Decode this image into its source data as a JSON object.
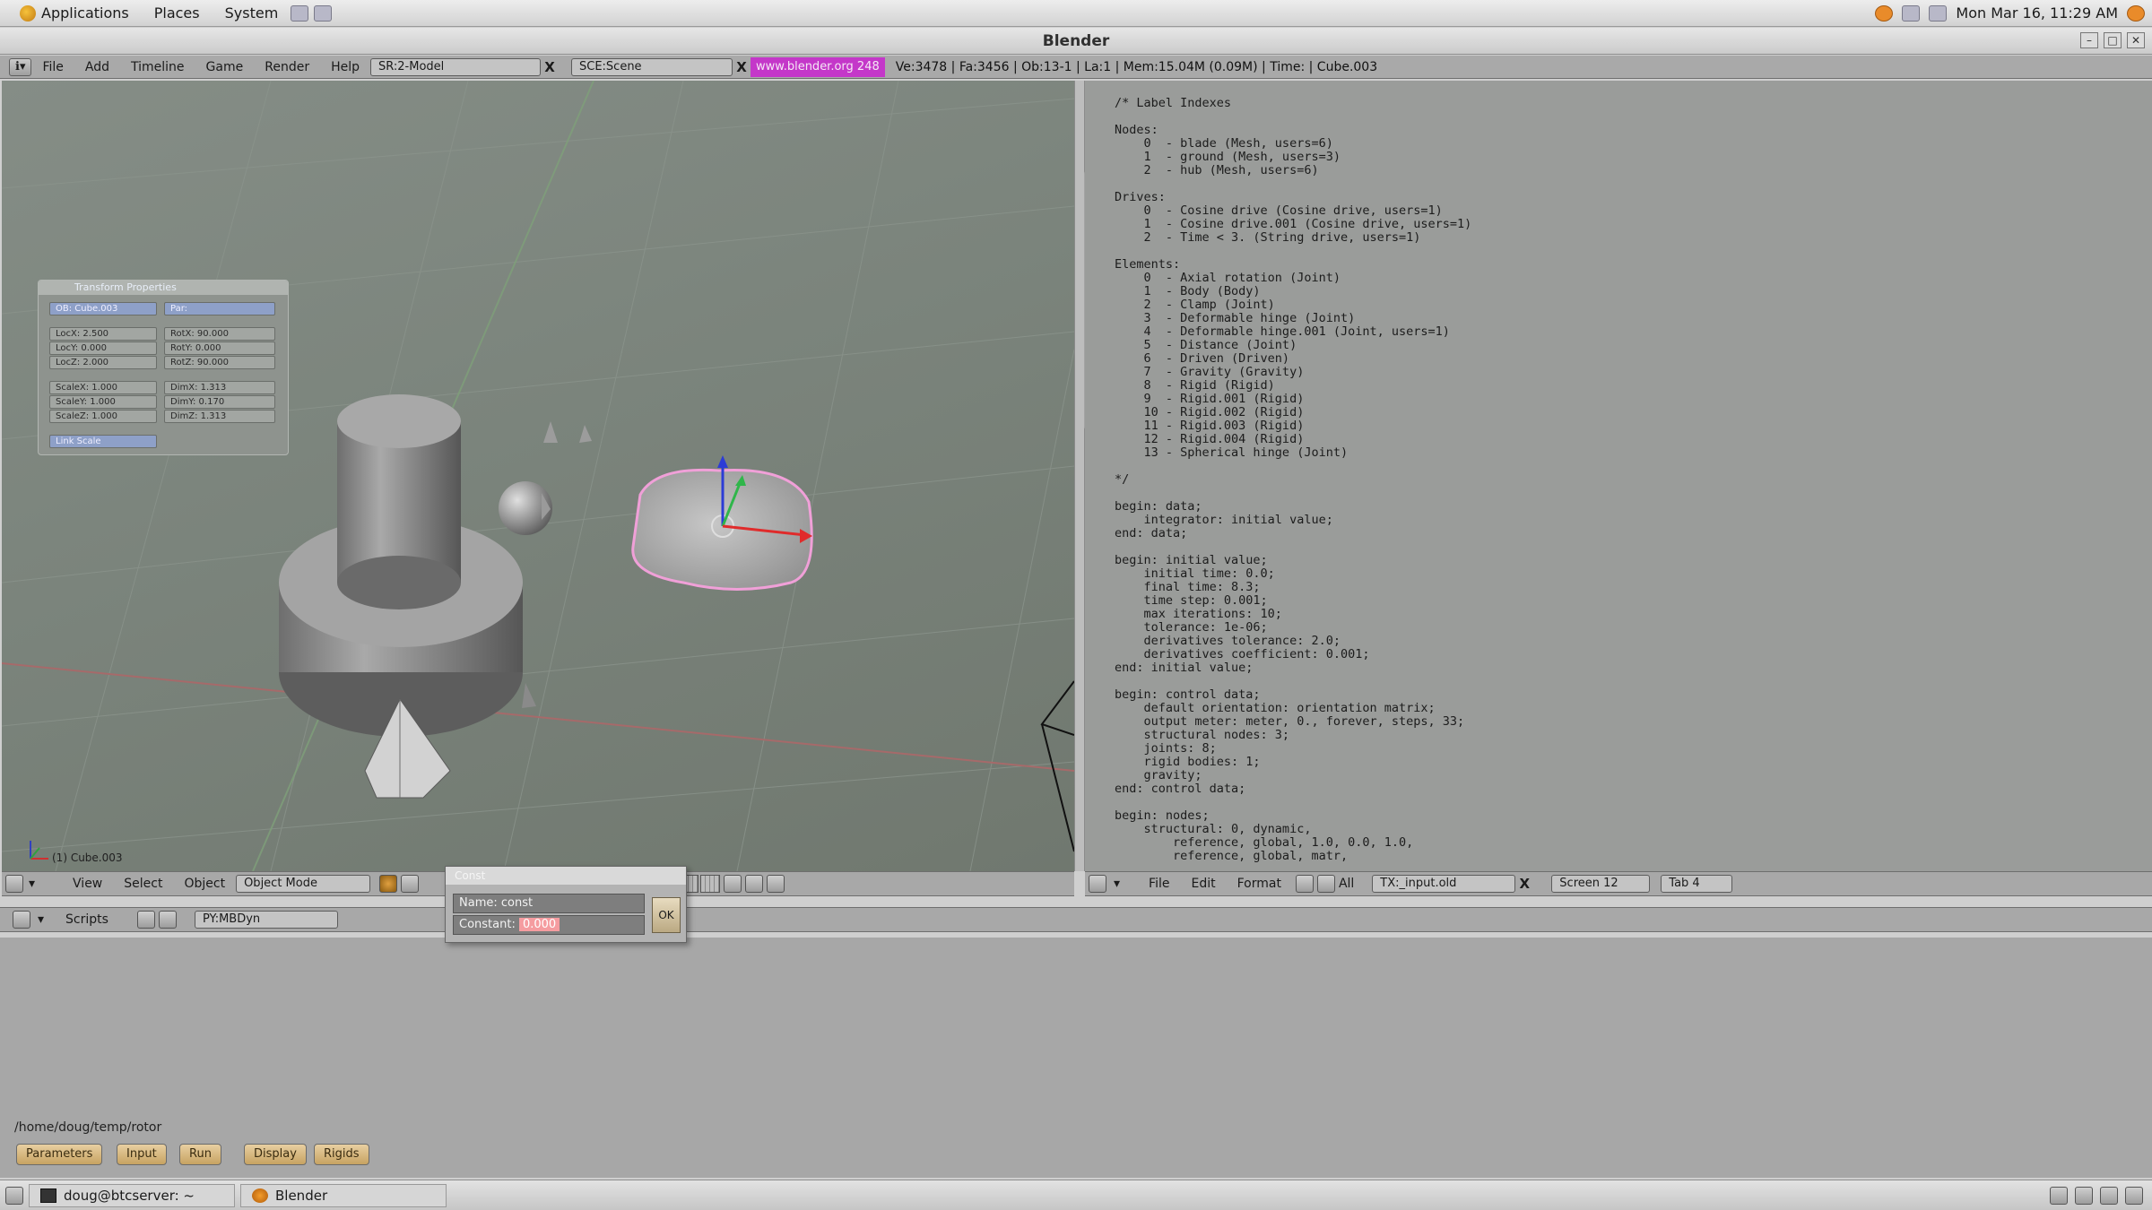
{
  "top_panel": {
    "menus": [
      "Applications",
      "Places",
      "System"
    ],
    "clock": "Mon Mar 16, 11:29 AM"
  },
  "window": {
    "title": "Blender"
  },
  "info_header": {
    "menus": [
      "File",
      "Add",
      "Timeline",
      "Game",
      "Render",
      "Help"
    ],
    "screen": "SR:2-Model",
    "scene": "SCE:Scene",
    "url": "www.blender.org 248",
    "stats": "Ve:3478 | Fa:3456 | Ob:13-1 | La:1  | Mem:15.04M (0.09M)  | Time: | Cube.003"
  },
  "transform_panel": {
    "title": "Transform Properties",
    "ob_name": "OB: Cube.003",
    "parent": "Par:",
    "loc": [
      "LocX: 2.500",
      "LocY: 0.000",
      "LocZ: 2.000"
    ],
    "rot": [
      "RotX: 90.000",
      "RotY: 0.000",
      "RotZ: 90.000"
    ],
    "scale": [
      "ScaleX: 1.000",
      "ScaleY: 1.000",
      "ScaleZ: 1.000"
    ],
    "dim": [
      "DimX: 1.313",
      "DimY: 0.170",
      "DimZ: 1.313"
    ],
    "link_scale": "Link Scale"
  },
  "viewport": {
    "object_label": "(1) Cube.003"
  },
  "viewport_header": {
    "menus": [
      "View",
      "Select",
      "Object"
    ],
    "mode": "Object Mode"
  },
  "text_editor": {
    "code": "/* Label Indexes\n\nNodes:\n    0  - blade (Mesh, users=6)\n    1  - ground (Mesh, users=3)\n    2  - hub (Mesh, users=6)\n\nDrives:\n    0  - Cosine drive (Cosine drive, users=1)\n    1  - Cosine drive.001 (Cosine drive, users=1)\n    2  - Time < 3. (String drive, users=1)\n\nElements:\n    0  - Axial rotation (Joint)\n    1  - Body (Body)\n    2  - Clamp (Joint)\n    3  - Deformable hinge (Joint)\n    4  - Deformable hinge.001 (Joint, users=1)\n    5  - Distance (Joint)\n    6  - Driven (Driven)\n    7  - Gravity (Gravity)\n    8  - Rigid (Rigid)\n    9  - Rigid.001 (Rigid)\n    10 - Rigid.002 (Rigid)\n    11 - Rigid.003 (Rigid)\n    12 - Rigid.004 (Rigid)\n    13 - Spherical hinge (Joint)\n\n*/\n\nbegin: data;\n    integrator: initial value;\nend: data;\n\nbegin: initial value;\n    initial time: 0.0;\n    final time: 8.3;\n    time step: 0.001;\n    max iterations: 10;\n    tolerance: 1e-06;\n    derivatives tolerance: 2.0;\n    derivatives coefficient: 0.001;\nend: initial value;\n\nbegin: control data;\n    default orientation: orientation matrix;\n    output meter: meter, 0., forever, steps, 33;\n    structural nodes: 3;\n    joints: 8;\n    rigid bodies: 1;\n    gravity;\nend: control data;\n\nbegin: nodes;\n    structural: 0, dynamic,\n        reference, global, 1.0, 0.0, 1.0,\n        reference, global, matr,"
  },
  "text_header": {
    "menus": [
      "File",
      "Edit",
      "Format"
    ],
    "all_label": "All",
    "textfile": "TX:_input.old",
    "screen": "Screen 12",
    "tab": "Tab 4"
  },
  "scripts_header": {
    "label": "Scripts",
    "pyfile": "PY:MBDyn"
  },
  "popup": {
    "title": "Const",
    "name_field": "Name: const",
    "constant_label": "Constant:",
    "constant_value": "0.000",
    "ok": "OK"
  },
  "scripts_area": {
    "path": "/home/doug/temp/rotor",
    "buttons": [
      "Parameters",
      "Input",
      "Run",
      "Display",
      "Rigids"
    ]
  },
  "taskbar": {
    "tasks": [
      "doug@btcserver: ~",
      "Blender"
    ]
  }
}
